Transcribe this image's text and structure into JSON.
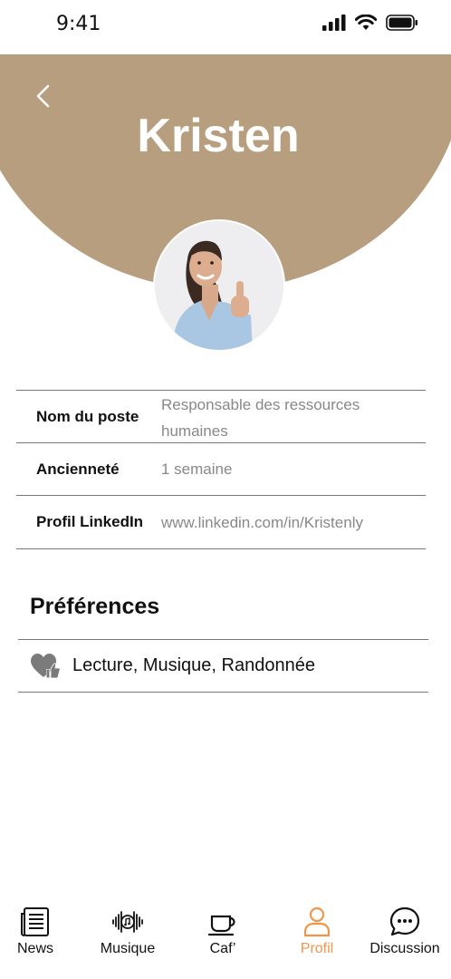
{
  "status_bar": {
    "time": "9:41"
  },
  "header": {
    "name": "Kristen",
    "accent_color": "#b79e7e"
  },
  "profile": {
    "rows": [
      {
        "label": "Nom du poste",
        "value": "Responsable des ressources humaines"
      },
      {
        "label": "Ancienneté",
        "value": "1 semaine"
      },
      {
        "label": "Profil LinkedIn",
        "value": "www.linkedin.com/in/Kristenly"
      }
    ]
  },
  "preferences": {
    "title": "Préférences",
    "items": "Lecture, Musique, Randonnée"
  },
  "tab_bar": {
    "active_color": "#f0954a",
    "tabs": [
      {
        "label": "News",
        "icon": "newspaper-icon"
      },
      {
        "label": "Musique",
        "icon": "music-icon"
      },
      {
        "label": "Caf’",
        "icon": "coffee-icon"
      },
      {
        "label": "Profil",
        "icon": "user-icon",
        "active": true
      },
      {
        "label": "Discussion",
        "icon": "chat-icon"
      }
    ]
  }
}
